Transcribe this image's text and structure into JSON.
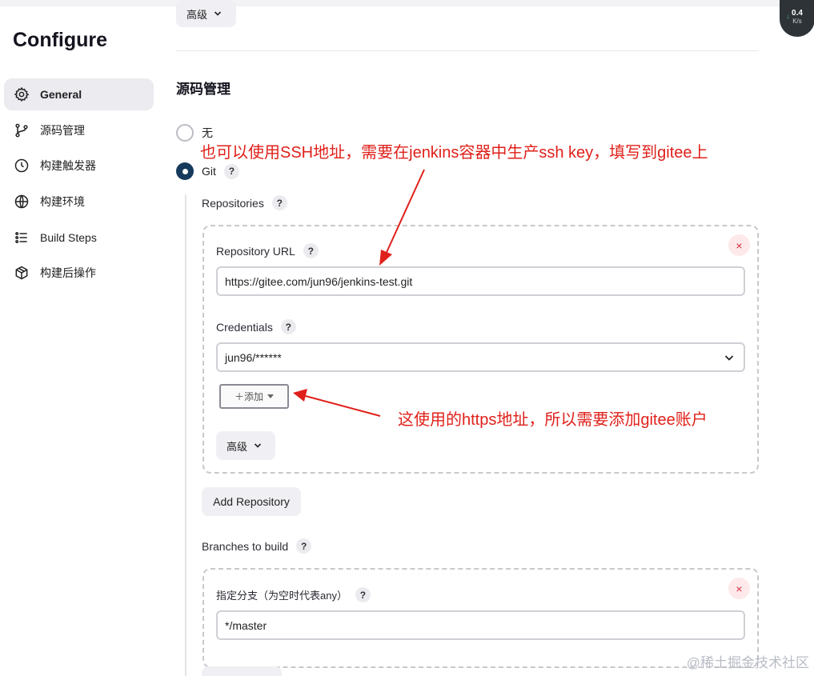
{
  "sidebar": {
    "title": "Configure",
    "items": [
      {
        "label": "General",
        "icon": "gear-icon"
      },
      {
        "label": "源码管理",
        "icon": "source-branch-icon"
      },
      {
        "label": "构建触发器",
        "icon": "clock-icon"
      },
      {
        "label": "构建环境",
        "icon": "globe-icon"
      },
      {
        "label": "Build Steps",
        "icon": "list-icon"
      },
      {
        "label": "构建后操作",
        "icon": "package-icon"
      }
    ]
  },
  "main": {
    "advanced_label": "高级",
    "section_title": "源码管理",
    "scm_options": [
      {
        "label": "无",
        "checked": false
      },
      {
        "label": "Git",
        "checked": true
      }
    ],
    "help_symbol": "?",
    "repositories_label": "Repositories",
    "repository": {
      "url_label": "Repository URL",
      "url_value": "https://gitee.com/jun96/jenkins-test.git",
      "credentials_label": "Credentials",
      "credentials_value": "jun96/******",
      "add_button": "＋添加",
      "advanced_label": "高级",
      "remove_symbol": "×"
    },
    "add_repository_label": "Add Repository",
    "branches_label": "Branches to build",
    "branch": {
      "specifier_label": "指定分支（为空时代表any）",
      "specifier_value": "*/master",
      "remove_symbol": "×"
    }
  },
  "annotations": {
    "top": "也可以使用SSH地址，需要在jenkins容器中生产ssh key，填写到gitee上",
    "middle": "这使用的https地址，所以需要添加gitee账户",
    "color": "#e0201a"
  },
  "network_widget": {
    "value": "0.4",
    "unit": "K/s"
  },
  "watermark": "@稀土掘金技术社区",
  "colors": {
    "accent": "#153a5c",
    "danger": "#d32f3f"
  }
}
